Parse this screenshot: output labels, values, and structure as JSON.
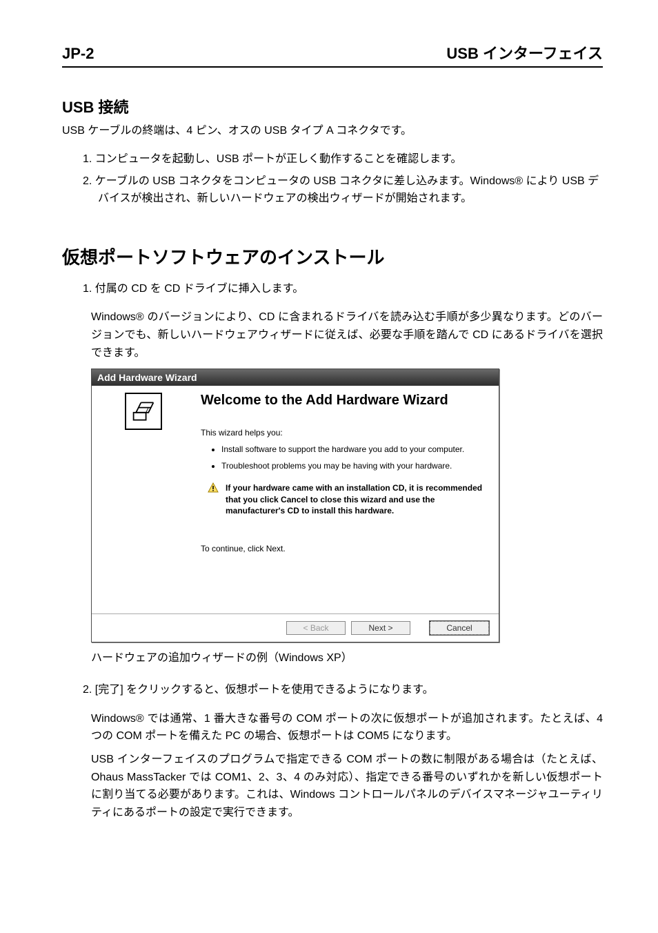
{
  "header": {
    "left": "JP-2",
    "right": "USB インターフェイス"
  },
  "section1": {
    "title": "USB 接続",
    "intro": "USB ケーブルの終端は、4 ピン、オスの USB タイプ A コネクタです。",
    "items": [
      "1. コンピュータを起動し、USB ポートが正しく動作することを確認します。",
      "2. ケーブルの USB コネクタをコンピュータの USB コネクタに差し込みます。Windows® により USB デバイスが検出され、新しいハードウェアの検出ウィザードが開始されます。"
    ]
  },
  "section2": {
    "title": "仮想ポートソフトウェアのインストール",
    "item1": "1. 付属の CD を CD ドライブに挿入します。",
    "item1_sub": "Windows® のバージョンにより、CD に含まれるドライバを読み込む手順が多少異なります。どのバージョンでも、新しいハードウェアウィザードに従えば、必要な手順を踏んで CD にあるドライバを選択できます。",
    "caption": "ハードウェアの追加ウィザードの例（Windows XP）",
    "item2": "2. [完了] をクリックすると、仮想ポートを使用できるようになります。",
    "item2_sub1": "Windows® では通常、1 番大きな番号の COM ポートの次に仮想ポートが追加されます。たとえば、4 つの COM ポートを備えた PC の場合、仮想ポートは COM5 になります。",
    "item2_sub2": "USB インターフェイスのプログラムで指定できる COM ポートの数に制限がある場合は（たとえば、Ohaus MassTacker では COM1、2、3、4 のみ対応）、指定できる番号のいずれかを新しい仮想ポートに割り当てる必要があります。これは、Windows コントロールパネルのデバイスマネージャユーティリティにあるポートの設定で実行できます。"
  },
  "wizard": {
    "title": "Add Hardware Wizard",
    "heading": "Welcome to the Add Hardware Wizard",
    "helps": "This wizard helps you:",
    "bullets": [
      "Install software to support the hardware you add to your computer.",
      "Troubleshoot problems you may be having with your hardware."
    ],
    "warning": "If your hardware came with an installation CD, it is recommended that you click Cancel to close this wizard and use the manufacturer's CD to install this hardware.",
    "continue": "To continue, click Next.",
    "buttons": {
      "back": "< Back",
      "next": "Next >",
      "cancel": "Cancel"
    }
  }
}
